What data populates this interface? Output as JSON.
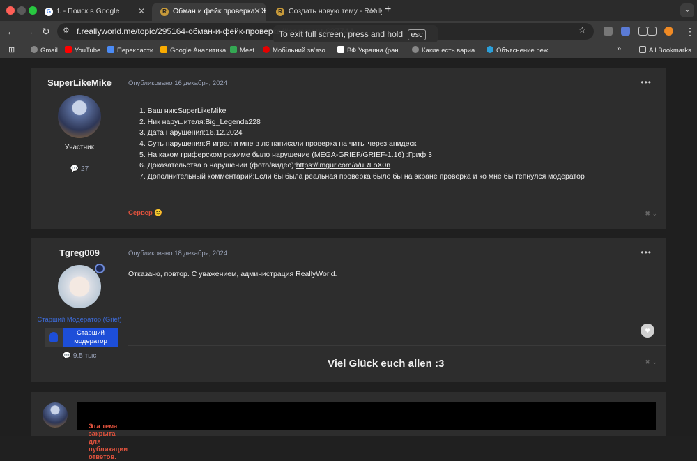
{
  "browser": {
    "tabs": [
      {
        "title": "f. - Поиск в Google",
        "favicon": "google-icon"
      },
      {
        "title": "Обман и фейк проверка - Ж",
        "favicon": "reallyworld-icon"
      },
      {
        "title": "Создать новую тему - Really",
        "favicon": "reallyworld-icon"
      }
    ],
    "new_tab": "+",
    "url": "f.reallyworld.me/topic/295164-обман-и-фейк-проверка/#comment-627744",
    "fullscreen_tip": "To exit full screen, press and hold",
    "fullscreen_key": "esc",
    "bookmarks": [
      "Gmail",
      "YouTube",
      "Перекласти",
      "Google Аналитика",
      "Meet",
      "Мобільний зв'язо...",
      "ВФ Украина (ран...",
      "Какие есть вариа...",
      "Объяснение реж..."
    ],
    "more": "»",
    "all_bookmarks": "All Bookmarks"
  },
  "posts": [
    {
      "author": "SuperLikeMike",
      "rank": "Участник",
      "count": "27",
      "date": "Опубликовано 16 декабря, 2024",
      "lines": [
        "1. Ваш ник:SuperLikeMike",
        "2. Ник нарушителя:Big_Legenda228",
        "3. Дата нарушения:16.12.2024",
        "4. Суть нарушения:Я играл и мне в лс написали проверка на читы через анидеск",
        "5. На каком гриферском режиме было нарушение (MEGA-GRIEF/GRIEF-1.16) :Гриф 3",
        "6. Доказательства о нарушении (фото/видео):",
        "7. Дополнительный комментарий:Если бы была реальная проверка было бы на экране проверка и ко мне бы тепнулся модератор"
      ],
      "proof_link": "https://imgur.com/a/uRLoX0n",
      "server_label": "Сервер"
    },
    {
      "author": "Tgreg009",
      "rank": "Старший Модератор (Grief)",
      "badge": "Старший модератор",
      "count": "9.5 тыс",
      "date": "Опубликовано 18 декабря, 2024",
      "text": "Отказано, повтор. С уважением, администрация ReallyWorld.",
      "signature": "Viel Glück euch allen :3"
    }
  ],
  "closed_notice": "Эта тема закрыта для публикации ответов.",
  "colors": {
    "accent_red": "#e0523d",
    "mod_blue": "#1d4ed8",
    "link_blue": "#3d6bd8"
  }
}
